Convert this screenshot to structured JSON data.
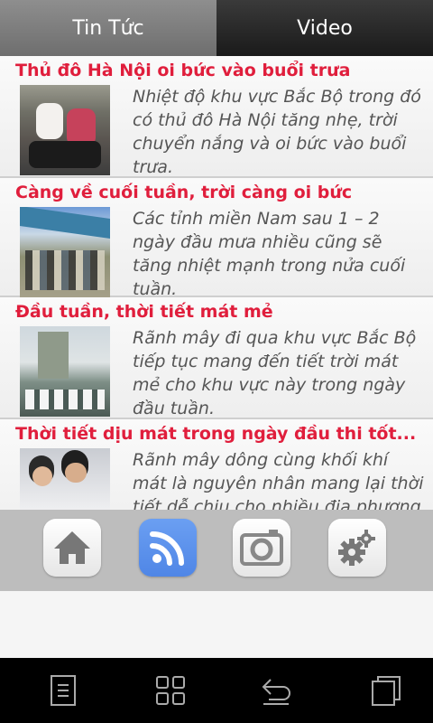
{
  "tabs": [
    {
      "label": "Tin Tức",
      "active": true
    },
    {
      "label": "Video",
      "active": false
    }
  ],
  "news": [
    {
      "title": "Thủ đô Hà Nội oi bức vào buổi trưa",
      "description": "Nhiệt độ khu vực Bắc Bộ trong đó có thủ đô Hà Nội tăng nhẹ, trời chuyển nắng và oi bức vào buổi trưa."
    },
    {
      "title": "Càng về cuối tuần, trời càng oi bức",
      "description": "Các tỉnh miền Nam sau 1 – 2 ngày đầu mưa nhiều cũng sẽ tăng nhiệt mạnh trong nửa cuối tuần."
    },
    {
      "title": "Đầu tuần, thời tiết mát mẻ",
      "description": "Rãnh mây đi qua khu vực Bắc Bộ tiếp tục mang đến tiết trời mát mẻ cho khu vực này trong ngày đầu tuần."
    },
    {
      "title": "Thời tiết dịu mát trong ngày đầu thi tốt...",
      "description": "Rãnh mây dông cùng khối khí mát là nguyên nhân mang lại thời tiết dễ chịu cho nhiều địa phương"
    }
  ],
  "toolbar": {
    "items": [
      {
        "icon": "home-icon",
        "active": false
      },
      {
        "icon": "rss-icon",
        "active": true
      },
      {
        "icon": "camera-icon",
        "active": false
      },
      {
        "icon": "gear-icon",
        "active": false
      }
    ],
    "active_color": "#5a8ff0"
  },
  "navbar": {
    "buttons": [
      "menu-icon",
      "apps-icon",
      "back-icon",
      "recents-icon"
    ]
  },
  "colors": {
    "title_red": "#e01e3c",
    "tab_active": "#7e7e7e",
    "tab_inactive": "#2a2a2a"
  }
}
